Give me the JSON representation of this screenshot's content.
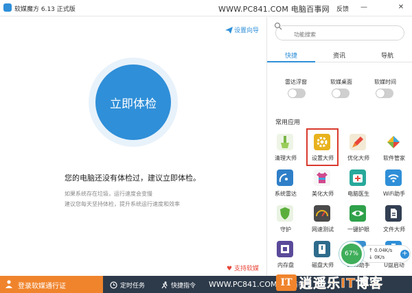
{
  "titlebar": {
    "app_title": "软媒魔方 6.13 正式版",
    "watermark": "WWW.PC841.COM 电脑百事网",
    "feedback": "反馈",
    "minimize": "—",
    "close": "✕"
  },
  "left": {
    "wizard": "设置向导",
    "check_button": "立即体检",
    "message": "您的电脑还没有体检过，建议立即体检。",
    "tips": [
      "如果系统存在垃圾，运行速度会变慢",
      "建议您每天坚持体检，提升系统运行速度和效率"
    ],
    "support": "支持软媒"
  },
  "right": {
    "search_placeholder": "功能搜索",
    "tabs": [
      "快捷",
      "资讯",
      "导航"
    ],
    "toggles": [
      {
        "label": "雷达浮窗",
        "on": false
      },
      {
        "label": "软媒桌面",
        "on": false
      },
      {
        "label": "软媒时间",
        "on": false
      }
    ],
    "section": "常用应用",
    "apps": [
      {
        "label": "清理大师",
        "color": "#7ab648"
      },
      {
        "label": "设置大师",
        "color": "#e8b21c"
      },
      {
        "label": "优化大师",
        "color": "#f1e7cf"
      },
      {
        "label": "软件管家",
        "color": "#f0f0f0"
      },
      {
        "label": "系统雷达",
        "color": "#2f7fc8"
      },
      {
        "label": "美化大师",
        "color": "#f6f6f6"
      },
      {
        "label": "电脑医生",
        "color": "#28a99b"
      },
      {
        "label": "WiFi助手",
        "color": "#2f8fd8"
      },
      {
        "label": "守护",
        "color": "#5aaf3c"
      },
      {
        "label": "网速测试",
        "color": "#4a4a4a"
      },
      {
        "label": "一键护眼",
        "color": "#2fa14a"
      },
      {
        "label": "文件大师",
        "color": "#333f52"
      },
      {
        "label": "内存盘",
        "color": "#5a4a9a"
      },
      {
        "label": "磁盘大师",
        "color": "#2e6b8c"
      },
      {
        "label": "DNS助手",
        "color": "#3a8fd0"
      },
      {
        "label": "U盘启动",
        "color": "#2f8fd8"
      }
    ]
  },
  "speed": {
    "percent": "67%",
    "up": "0.04K/s",
    "down": "0K/s"
  },
  "bottom": {
    "login": "登录软媒通行证",
    "tasks": "定时任务",
    "shortcut": "快捷指令",
    "watermark": "WWW.PC841.COM",
    "watermark_suffix": "电脑百事",
    "brand_it": "IT",
    "brand_text": "逍遥乐IT博客"
  },
  "colors": {
    "accent": "#2f8fd8",
    "orange": "#f0842c",
    "bottom_bar": "#2d3a4a",
    "highlight": "#d93a2e"
  }
}
